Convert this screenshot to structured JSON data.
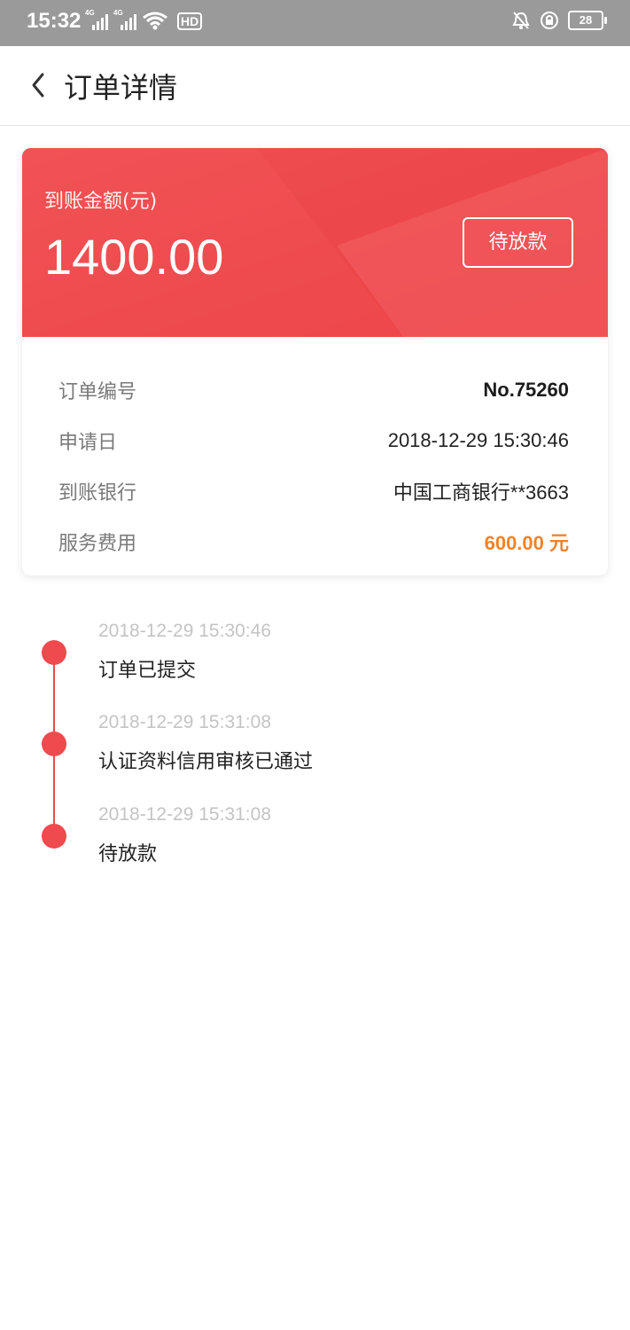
{
  "status_bar": {
    "time": "15:32",
    "signal_tag_1": "4G",
    "signal_tag_2": "4G",
    "hd_label": "HD",
    "battery": "28",
    "icons": [
      "signal-icon",
      "wifi-icon",
      "alarm-off-icon",
      "lock-rotation-icon",
      "battery-icon"
    ]
  },
  "nav": {
    "title": "订单详情",
    "back_icon": "chevron-left-icon"
  },
  "summary": {
    "amount_label": "到账金额(元)",
    "amount": "1400.00",
    "status": "待放款",
    "accent_color": "#ef4a4e"
  },
  "details": [
    {
      "label": "订单编号",
      "value": "No.75260"
    },
    {
      "label": "申请日",
      "value": "2018-12-29 15:30:46"
    },
    {
      "label": "到账银行",
      "value": "中国工商银行**3663"
    },
    {
      "label": "服务费用",
      "value": "600.00 元"
    }
  ],
  "fee_color": "#f0832a",
  "timeline": [
    {
      "time": "2018-12-29 15:30:46",
      "text": "订单已提交"
    },
    {
      "time": "2018-12-29 15:31:08",
      "text": "认证资料信用审核已通过"
    },
    {
      "time": "2018-12-29 15:31:08",
      "text": "待放款"
    }
  ]
}
